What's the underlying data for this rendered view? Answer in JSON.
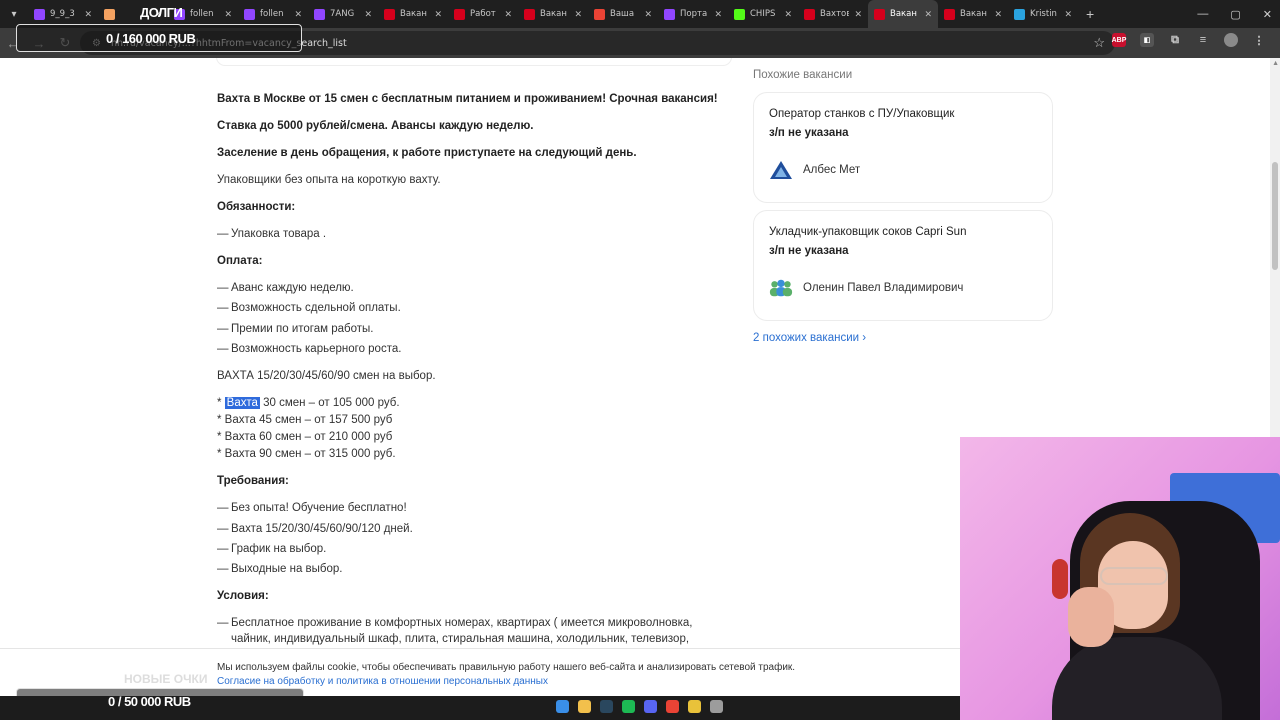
{
  "browser": {
    "tabs": [
      {
        "label": "9_9_3",
        "color": "#9146ff"
      },
      {
        "label": "",
        "color": "#f4a261"
      },
      {
        "label": "follen",
        "color": "#9146ff"
      },
      {
        "label": "follen",
        "color": "#9146ff"
      },
      {
        "label": "7ANG",
        "color": "#9146ff"
      },
      {
        "label": "Вакан",
        "color": "#d6001c"
      },
      {
        "label": "Работ",
        "color": "#d6001c"
      },
      {
        "label": "Вакан",
        "color": "#d6001c"
      },
      {
        "label": "Ваша",
        "color": "#ea4335"
      },
      {
        "label": "Порта",
        "color": "#9146ff"
      },
      {
        "label": "CHIPS",
        "color": "#53fc18"
      },
      {
        "label": "Вахтов",
        "color": "#d6001c"
      },
      {
        "label": "Вакан",
        "color": "#d6001c",
        "active": true
      },
      {
        "label": "Вакан",
        "color": "#d6001c"
      },
      {
        "label": "Kristin",
        "color": "#2aa3df"
      }
    ],
    "url": "hh.ru/vacancy/...?hhtmFrom=vacancy_search_list",
    "new_tab": "+"
  },
  "overlay": {
    "goal_top_title": "ДОЛГИ",
    "goal_top_value": "0 / 160 000 RUB",
    "goal_bottom_title": "НОВЫЕ ОЧКИ",
    "goal_bottom_value": "0 / 50 000 RUB"
  },
  "vacancy": {
    "intro_1": "Вахта в Москве от 15 смен с бесплатным питанием и проживанием! Срочная вакансия!",
    "intro_2": "Ставка до 5000 рублей/смена. Авансы каждую неделю.",
    "intro_3": "Заселение в день обращения, к работе приступаете на следующий день.",
    "intro_4": "Упаковщики без опыта на короткую вахту.",
    "duties_heading": "Обязанности:",
    "duties": [
      "Упаковка товара ."
    ],
    "pay_heading": "Оплата:",
    "pay": [
      "Аванс каждую неделю.",
      "Возможность сдельной оплаты.",
      "Премии по итогам работы.",
      "Возможность карьерного роста."
    ],
    "shifts_line": "ВАХТА 15/20/30/45/60/90 смен на выбор.",
    "shift_prices": {
      "first_prefix": "* ",
      "first_highlight": "Вахта",
      "first_rest": " 30 смен – от 105 000 руб.",
      "second": "* Вахта 45 смен – от 157 500 руб",
      "third": "* Вахта 60 смен – от 210 000 руб",
      "fourth": "* Вахта 90 смен – от 315 000 руб."
    },
    "req_heading": "Требования:",
    "requirements": [
      "Без опыта! Обучение бесплатно!",
      "Вахта 15/20/30/45/60/90/120 дней.",
      "График на выбор.",
      "Выходные на выбор."
    ],
    "cond_heading": "Условия:",
    "conditions": [
      "Бесплатное проживание в комфортных номерах, квартирах ( имеется микроволновка, чайник, индивидуальный шкаф, плита, стиральная машина, холодильник, телевизор,"
    ],
    "dash": "—"
  },
  "similar": {
    "title": "Похожие вакансии",
    "cards": [
      {
        "title": "Оператор станков с ПУ/Упаковщик",
        "salary": "з/п не указана",
        "company": "Албес Мет"
      },
      {
        "title": "Укладчик-упаковщик соков Capri Sun",
        "salary": "з/п не указана",
        "company": "Оленин Павел Владимирович"
      }
    ],
    "more": "2 похожих вакансии"
  },
  "cookie": {
    "text": "Мы используем файлы cookie, чтобы обеспечивать правильную работу нашего веб-сайта и анализировать сетевой трафик.",
    "link": "Согласие на обработку и политика в отношении персональных данных"
  },
  "taskbar": {
    "icons": [
      {
        "name": "windows-start-icon",
        "color": "#3a8fe8"
      },
      {
        "name": "file-explorer-icon",
        "color": "#f2c04c"
      },
      {
        "name": "steam-icon",
        "color": "#2a475e"
      },
      {
        "name": "spotify-icon",
        "color": "#1db954"
      },
      {
        "name": "discord-icon",
        "color": "#5865f2"
      },
      {
        "name": "chrome-icon",
        "color": "#ea4335"
      },
      {
        "name": "obs-icon",
        "color": "#e9c23a"
      },
      {
        "name": "app-icon",
        "color": "#9c9c9c"
      }
    ]
  }
}
